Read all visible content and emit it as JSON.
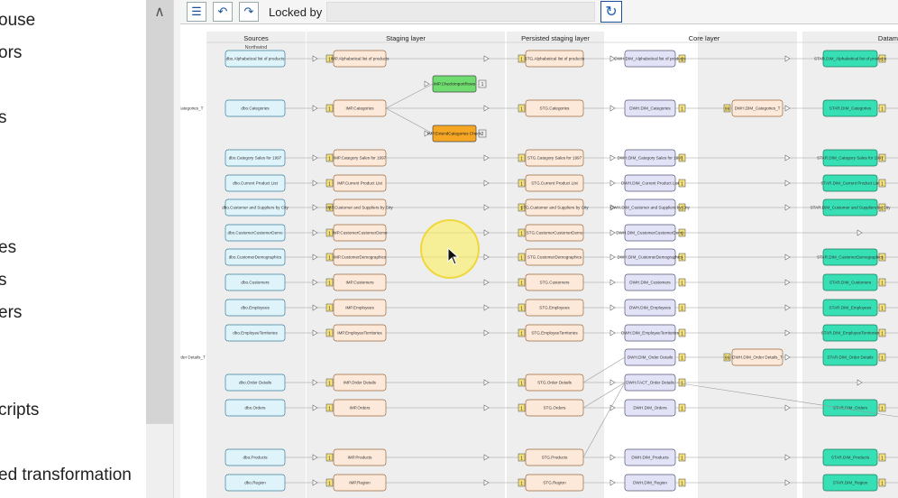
{
  "nav": {
    "items": [
      "ouse",
      "ors",
      "s",
      "es",
      "s",
      "ers",
      "cripts",
      "ed transformation"
    ]
  },
  "toolbar": {
    "locked_label": "Locked by",
    "locked_value": "",
    "buttons": [
      "list-tree-icon",
      "undo-icon",
      "redo-icon",
      "refresh-icon"
    ]
  },
  "columns": [
    "Sources",
    "Staging layer",
    "Persisted staging layer",
    "Core layer",
    "Datam"
  ],
  "sub_header": "Northwind",
  "colors": {
    "source": "#dff3fb",
    "staging": "#fde9da",
    "core": "#e3e3f7",
    "mart": "#36e0b4",
    "check_ok": "#6fdc6f",
    "check_warn": "#f5a623",
    "badge": "#f6e27a",
    "lane": "#eeeeee"
  },
  "rows": [
    {
      "src": "dbo.Alphabetical list of products",
      "imp": "IMP.Alphabetical list of products",
      "stg": "STG.Alphabetical list of products",
      "dwh": "DWH.DIM_Alphabetical list of products",
      "star": "STAR.DIM_Alphabetical list of products"
    },
    {
      "src": "dbo.Categories",
      "imp": "IMP.Categories",
      "stg": "STG.Categories",
      "dwh": "DWH.DIM_Categories",
      "dwh2": "DWH.DIM_Categories_T",
      "star": "STAR.DIM_Categories"
    },
    {
      "src": "dbo.Category Sales for 1997",
      "imp": "IMP.Category Sales for 1997",
      "stg": "STG.Category Sales for 1997",
      "dwh": "DWH.DIM_Category Sales for 1997",
      "star": "STAR.DIM_Category Sales for 1997"
    },
    {
      "src": "dbo.Current Product List",
      "imp": "IMP.Current Product List",
      "stg": "STG.Current Product List",
      "dwh": "DWH.DIM_Current Product List",
      "star": "STAR.DIM_Current Product List"
    },
    {
      "src": "dbo.Customer and Suppliers by City",
      "imp": "IMP.Customer and Suppliers by City",
      "stg": "STG.Customer and Suppliers by City",
      "dwh": "DWH.DIM_Customer and Suppliers by City",
      "star": "STAR.DIM_Customer and Suppliers by City"
    },
    {
      "src": "dbo.CustomerCustomerDemo",
      "imp": "IMP.CustomerCustomerDemo",
      "stg": "STG.CustomerCustomerDemo",
      "dwh": "DWH.DIM_CustomerCustomerDemo",
      "star": ""
    },
    {
      "src": "dbo.CustomerDemographics",
      "imp": "IMP.CustomerDemographics",
      "stg": "STG.CustomerDemographics",
      "dwh": "DWH.DIM_CustomerDemographics",
      "star": "STAR.DIM_CustomerDemographics"
    },
    {
      "src": "dbo.Customers",
      "imp": "IMP.Customers",
      "stg": "STG.Customers",
      "dwh": "DWH.DIM_Customers",
      "star": "STAR.DIM_Customers"
    },
    {
      "src": "dbo.Employees",
      "imp": "IMP.Employees",
      "stg": "STG.Employees",
      "dwh": "DWH.DIM_Employees",
      "star": "STAR.DIM_Employees"
    },
    {
      "src": "dbo.EmployeeTerritories",
      "imp": "IMP.EmployeeTerritories",
      "stg": "STG.EmployeeTerritories",
      "dwh": "DWH.DIM_EmployeeTerritories",
      "star": "STAR.DIM_EmployeeTerritories"
    },
    {
      "src": "",
      "imp": "",
      "stg": "",
      "dwh": "DWH.DIM_Order Details",
      "dwh2": "DWH.DIM_Order Details_T",
      "star": "STAR.DIM_Order Details"
    },
    {
      "src": "dbo.Order Details",
      "imp": "IMP.Order Details",
      "stg": "STG.Order Details",
      "dwh": "DWH.FACT_Order Details",
      "star": ""
    },
    {
      "src": "dbo.Orders",
      "imp": "IMP.Orders",
      "stg": "STG.Orders",
      "dwh": "DWH.DIM_Orders",
      "star": "STAR.DIM_Orders"
    },
    {
      "src": "dbo.Products",
      "imp": "IMP.Products",
      "stg": "STG.Products",
      "dwh": "DWH.DIM_Products",
      "star": "STAR.DIM_Products"
    },
    {
      "src": "dbo.Region",
      "imp": "IMP.Region",
      "stg": "STG.Region",
      "dwh": "DWH.DIM_Region",
      "star": "STAR.DIM_Region"
    }
  ],
  "checks": [
    {
      "label": "IMP.CheckImportRows",
      "status": "ok",
      "count": "1"
    },
    {
      "label": "IMP.ExtendCategories Check",
      "status": "warn",
      "count": "2"
    }
  ]
}
